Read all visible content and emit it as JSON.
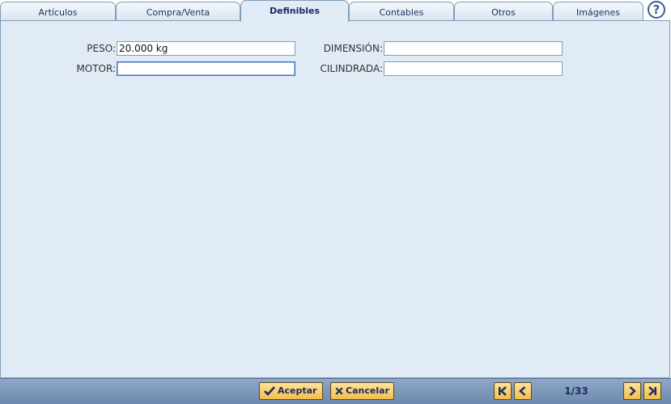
{
  "tabs": [
    {
      "label": "Artículos"
    },
    {
      "label": "Compra/Venta"
    },
    {
      "label": "Definibles"
    },
    {
      "label": "Contables"
    },
    {
      "label": "Otros"
    },
    {
      "label": "Imágenes"
    }
  ],
  "active_tab": "Definibles",
  "help_symbol": "?",
  "form": {
    "peso": {
      "label": "PESO:",
      "value": "20.000 kg"
    },
    "dimension": {
      "label": "DIMENSIÓN:",
      "value": ""
    },
    "motor": {
      "label": "MOTOR:",
      "value": ""
    },
    "cilindrada": {
      "label": "CILINDRADA:",
      "value": ""
    }
  },
  "buttons": {
    "accept_label": "Aceptar",
    "cancel_label": "Cancelar"
  },
  "pager": {
    "text": "1/33"
  },
  "colors": {
    "panel_bg": "#e1ebf5",
    "button_bg": "#f3bd4b",
    "accent": "#1b2c63"
  }
}
